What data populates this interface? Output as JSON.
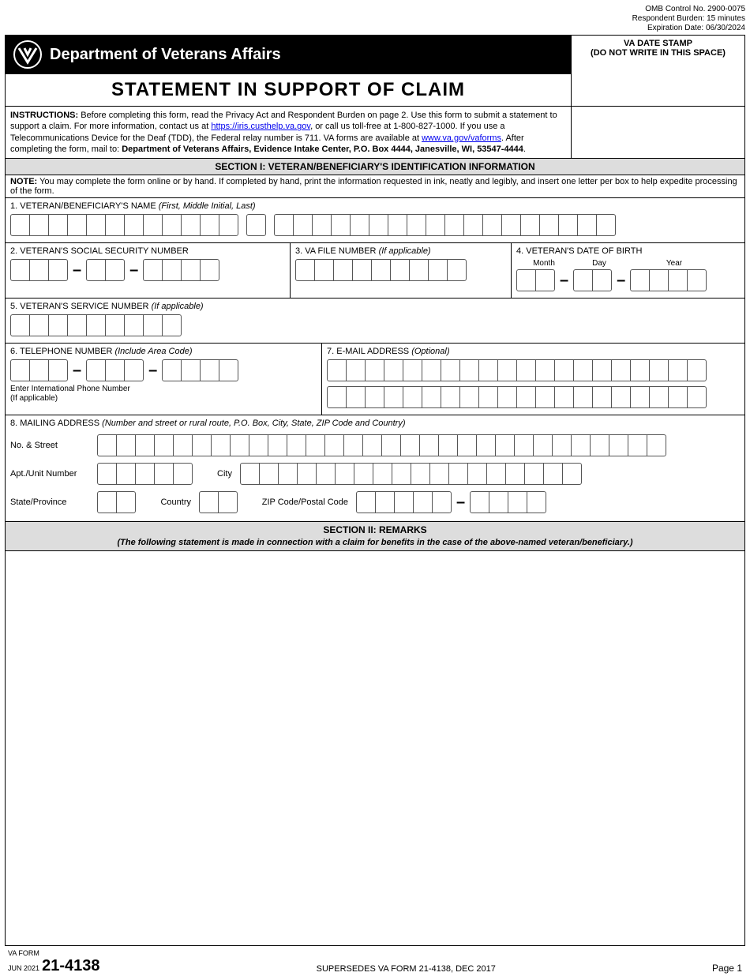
{
  "meta": {
    "omb": "OMB Control No. 2900-0075",
    "burden": "Respondent Burden: 15 minutes",
    "expiration": "Expiration Date: 06/30/2024"
  },
  "header": {
    "dept": "Department of Veterans Affairs",
    "datestamp_line1": "VA DATE STAMP",
    "datestamp_line2": "(DO NOT WRITE IN THIS SPACE)"
  },
  "title": "STATEMENT IN SUPPORT OF CLAIM",
  "instructions": {
    "label": "INSTRUCTIONS:",
    "text1": " Before completing this form, read the Privacy Act and Respondent Burden on page 2. Use this form to submit a statement to support a claim. For more information, contact us at ",
    "link1": "https://iris.custhelp.va.gov",
    "text2": ", or call us toll-free at 1-800-827-1000. If you use a Telecommunications Device for the Deaf (TDD), the Federal relay number is 711. VA forms are available at ",
    "link2": "www.va.gov/vaforms",
    "text3": ". After completing the form, mail to: ",
    "bold_tail": "Department of Veterans Affairs, Evidence Intake Center, P.O. Box 4444, Janesville, WI, 53547-4444",
    "period": "."
  },
  "section1": {
    "title": "SECTION I:  VETERAN/BENEFICIARY'S IDENTIFICATION INFORMATION",
    "note_label": "NOTE:",
    "note_text": " You may complete the form online or by hand. If completed by hand, print the information requested in ink, neatly and legibly, and insert one letter per box to help expedite processing of the form."
  },
  "fields": {
    "f1": {
      "label": "1. VETERAN/BENEFICIARY'S NAME ",
      "hint": "(First, Middle Initial, Last)"
    },
    "f2": {
      "label": "2. VETERAN'S SOCIAL SECURITY NUMBER"
    },
    "f3": {
      "label": "3. VA FILE NUMBER ",
      "hint": "(If applicable)"
    },
    "f4": {
      "label": "4. VETERAN'S DATE OF BIRTH",
      "month": "Month",
      "day": "Day",
      "year": "Year"
    },
    "f5": {
      "label": "5. VETERAN'S SERVICE NUMBER ",
      "hint": "(If applicable)"
    },
    "f6": {
      "label": "6. TELEPHONE NUMBER ",
      "hint": "(Include Area Code)",
      "sub": "Enter International Phone Number\n(If applicable)"
    },
    "f7": {
      "label": "7. E-MAIL ADDRESS ",
      "hint": "(Optional)"
    },
    "f8": {
      "label": "8. MAILING ADDRESS ",
      "hint": "(Number and street or rural route, P.O. Box, City, State, ZIP Code and Country)"
    },
    "addr": {
      "no_street": "No. & Street",
      "apt": "Apt./Unit Number",
      "city": "City",
      "state": "State/Province",
      "country": "Country",
      "zip": "ZIP Code/Postal Code"
    }
  },
  "section2": {
    "title": "SECTION II:  REMARKS",
    "sub": "(The following statement is made in connection with a claim for benefits in the case of the above-named veteran/beneficiary.)"
  },
  "footer": {
    "va_form": "VA FORM",
    "date": "JUN 2021",
    "number": "21-4138",
    "supersedes": "SUPERSEDES VA FORM 21-4138, DEC 2017",
    "page": "Page 1"
  }
}
